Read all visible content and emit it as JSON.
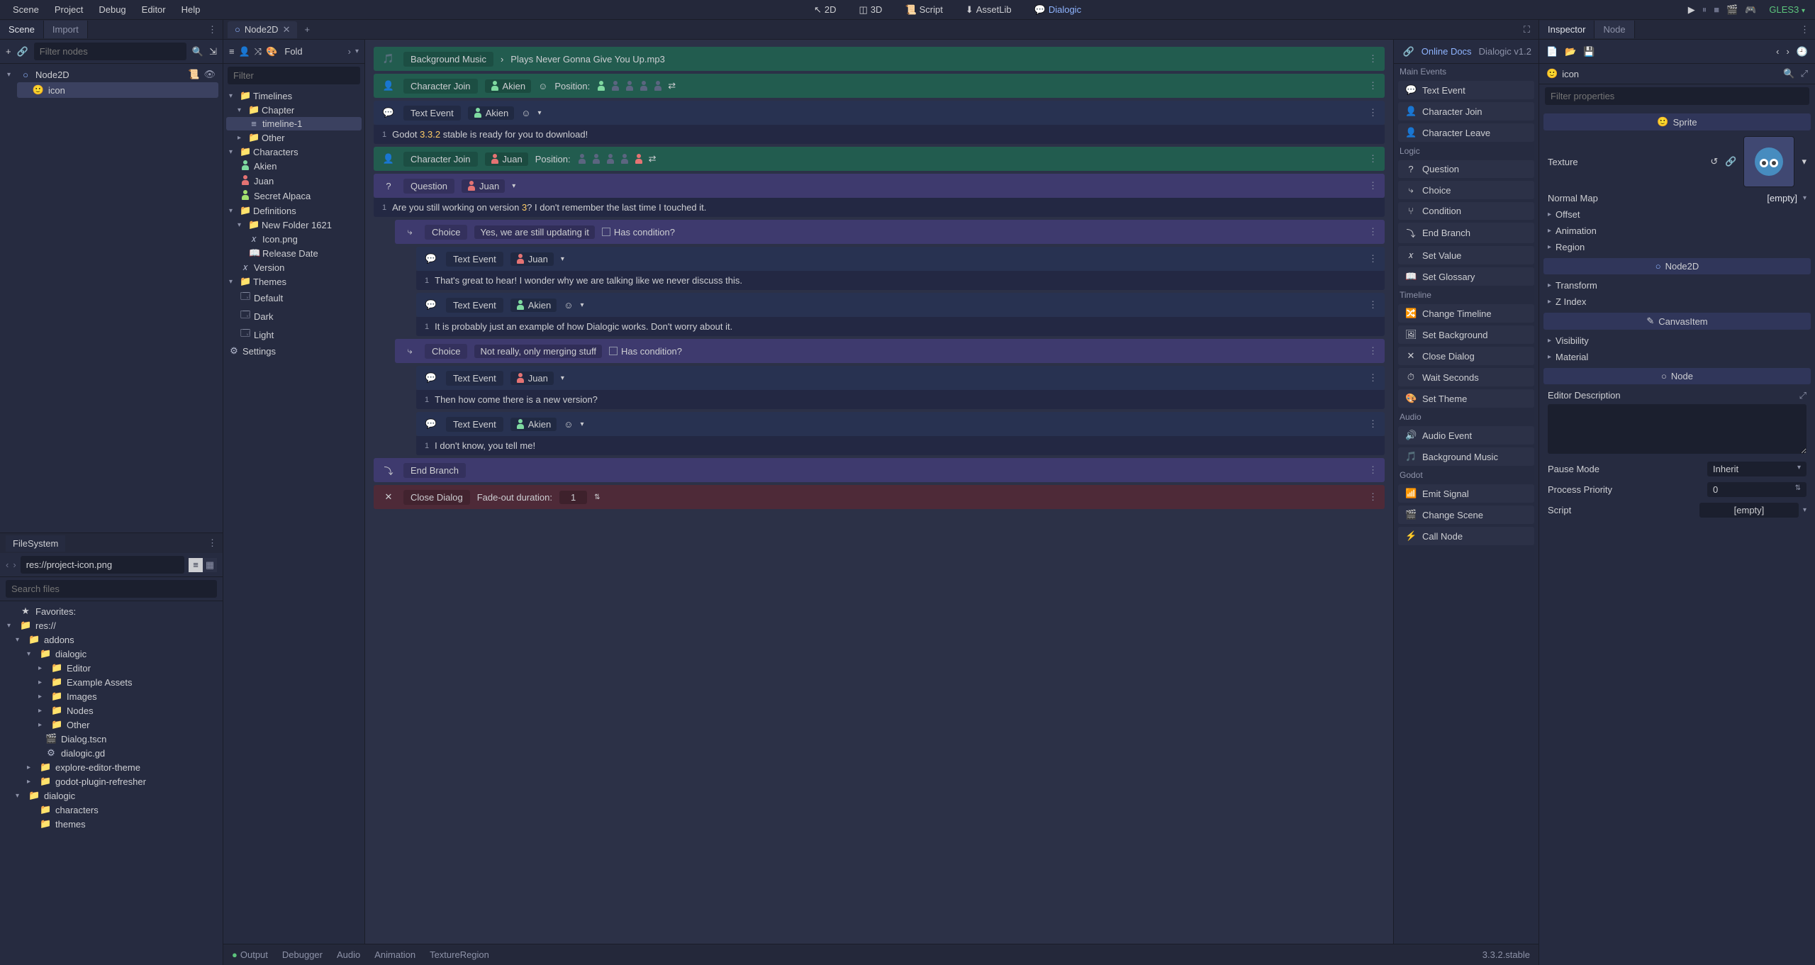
{
  "menubar": {
    "items": [
      "Scene",
      "Project",
      "Debug",
      "Editor",
      "Help"
    ],
    "modes": {
      "d2": "2D",
      "d3": "3D",
      "script": "Script",
      "assetlib": "AssetLib",
      "dialogic": "Dialogic"
    },
    "renderer": "GLES3"
  },
  "scene_dock": {
    "tabs": {
      "scene": "Scene",
      "import": "Import"
    },
    "filter_placeholder": "Filter nodes",
    "root": "Node2D",
    "child": "icon"
  },
  "filesystem": {
    "title": "FileSystem",
    "path": "res://project-icon.png",
    "search_placeholder": "Search files",
    "favorites": "Favorites:",
    "tree": {
      "res": "res://",
      "addons": "addons",
      "dialogic": "dialogic",
      "editor": "Editor",
      "example": "Example Assets",
      "images": "Images",
      "nodes": "Nodes",
      "other": "Other",
      "dialog_tscn": "Dialog.tscn",
      "dialogic_gd": "dialogic.gd",
      "explore": "explore-editor-theme",
      "refresher": "godot-plugin-refresher",
      "dialogic2": "dialogic",
      "characters": "characters",
      "themes": "themes"
    }
  },
  "center": {
    "tab": "Node2D",
    "fold": "Fold"
  },
  "d_left": {
    "filter_placeholder": "Filter",
    "timelines": "Timelines",
    "chapter": "Chapter",
    "timeline1": "timeline-1",
    "other": "Other",
    "characters": "Characters",
    "akien": "Akien",
    "juan": "Juan",
    "alpaca": "Secret Alpaca",
    "definitions": "Definitions",
    "newfolder": "New Folder 1621",
    "icon_png": "Icon.png",
    "release_date": "Release Date",
    "version": "Version",
    "themes": "Themes",
    "default": "Default",
    "dark": "Dark",
    "light": "Light",
    "settings": "Settings"
  },
  "timeline": {
    "bgmusic": {
      "label": "Background Music",
      "plays": "Plays Never Gonna Give You Up.mp3"
    },
    "cj1": {
      "label": "Character Join",
      "char": "Akien",
      "position": "Position:"
    },
    "te1": {
      "label": "Text Event",
      "char": "Akien"
    },
    "te1_body": "Godot 3.3.2 stable is ready for you to download!",
    "cj2": {
      "label": "Character Join",
      "char": "Juan",
      "position": "Position:"
    },
    "q1": {
      "label": "Question",
      "char": "Juan"
    },
    "q1_body": "Are you still working on version 3? I don't remember the last time I touched it.",
    "ch1": {
      "label": "Choice",
      "text": "Yes, we are still updating it",
      "cond": "Has condition?"
    },
    "te2": {
      "label": "Text Event",
      "char": "Juan"
    },
    "te2_body": "That's great to hear! I wonder why we are talking like we never discuss this.",
    "te3": {
      "label": "Text Event",
      "char": "Akien"
    },
    "te3_body": "It is probably just an example of how Dialogic works. Don't worry about it.",
    "ch2": {
      "label": "Choice",
      "text": "Not really, only merging stuff",
      "cond": "Has condition?"
    },
    "te4": {
      "label": "Text Event",
      "char": "Juan"
    },
    "te4_body": "Then how come there is a new version?",
    "te5": {
      "label": "Text Event",
      "char": "Akien"
    },
    "te5_body": "I don't know, you tell me!",
    "endbr": "End Branch",
    "close": {
      "label": "Close Dialog",
      "fadeout": "Fade-out duration:",
      "val": "1"
    }
  },
  "d_right": {
    "online": "Online Docs",
    "version": "Dialogic v1.2",
    "sections": {
      "main": "Main Events",
      "logic": "Logic",
      "tl": "Timeline",
      "audio": "Audio",
      "godot": "Godot"
    },
    "items": {
      "text_event": "Text Event",
      "char_join": "Character Join",
      "char_leave": "Character Leave",
      "question": "Question",
      "choice": "Choice",
      "condition": "Condition",
      "end_branch": "End Branch",
      "set_value": "Set Value",
      "set_glossary": "Set Glossary",
      "change_tl": "Change Timeline",
      "set_bg": "Set Background",
      "close_dialog": "Close Dialog",
      "wait": "Wait Seconds",
      "set_theme": "Set Theme",
      "audio_event": "Audio Event",
      "bgmusic": "Background Music",
      "emit": "Emit Signal",
      "change_scene": "Change Scene",
      "call_node": "Call Node"
    }
  },
  "inspector": {
    "tabs": {
      "inspector": "Inspector",
      "node": "Node"
    },
    "obj_name": "icon",
    "filter_placeholder": "Filter properties",
    "class_sprite": "Sprite",
    "texture": "Texture",
    "normalmap": "Normal Map",
    "empty": "[empty]",
    "offset": "Offset",
    "animation": "Animation",
    "region": "Region",
    "class_node2d": "Node2D",
    "transform": "Transform",
    "zindex": "Z Index",
    "class_canvas": "CanvasItem",
    "visibility": "Visibility",
    "material": "Material",
    "class_node": "Node",
    "editor_desc": "Editor Description",
    "pause_mode": "Pause Mode",
    "inherit": "Inherit",
    "process_prio": "Process Priority",
    "prio_val": "0",
    "script": "Script"
  },
  "bottom": {
    "output": "Output",
    "debugger": "Debugger",
    "audio": "Audio",
    "animation": "Animation",
    "texregion": "TextureRegion",
    "version": "3.3.2.stable"
  }
}
